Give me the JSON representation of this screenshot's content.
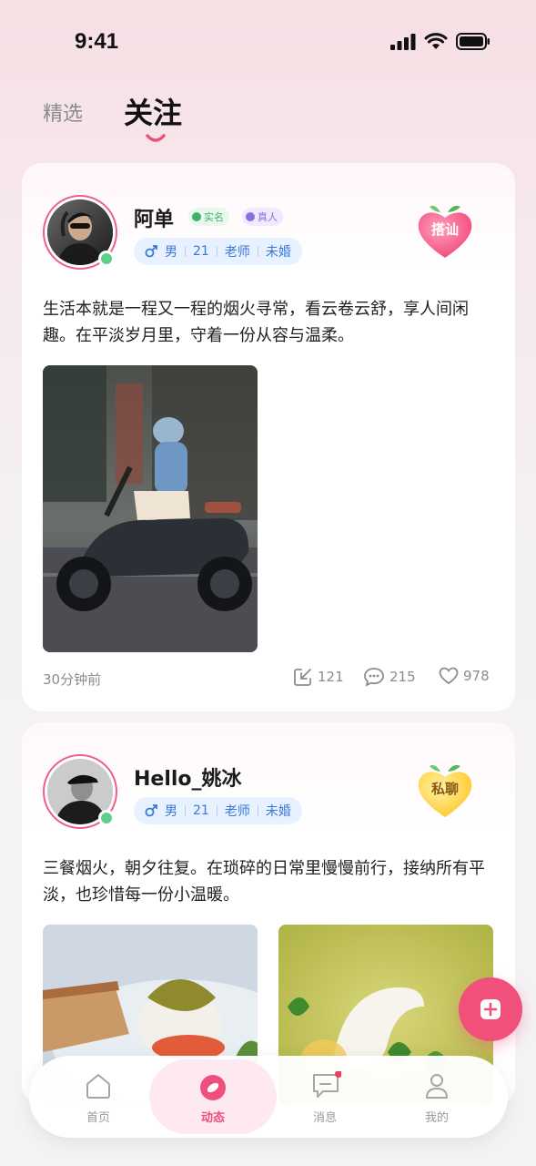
{
  "status_bar": {
    "time": "9:41"
  },
  "tabs": [
    {
      "label": "精选",
      "active": false
    },
    {
      "label": "关注",
      "active": true
    }
  ],
  "posts": [
    {
      "username": "阿单",
      "badges": [
        "实名",
        "真人"
      ],
      "tags": [
        "男",
        "21",
        "老师",
        "未婚"
      ],
      "action": "搭讪",
      "text": "生活本就是一程又一程的烟火寻常，看云卷云舒，享人间闲趣。在平淡岁月里，守着一份从容与温柔。",
      "time": "30分钟前",
      "shares": "121",
      "comments": "215",
      "likes": "978"
    },
    {
      "username": "Hello_姚冰",
      "badges": [],
      "tags": [
        "男",
        "21",
        "老师",
        "未婚"
      ],
      "action": "私聊",
      "text": "三餐烟火，朝夕往复。在琐碎的日常里慢慢前行，接纳所有平淡，也珍惜每一份小温暖。"
    }
  ],
  "bottom_nav": [
    {
      "label": "首页",
      "icon": "home-icon",
      "active": false
    },
    {
      "label": "动态",
      "icon": "feed-icon",
      "active": true
    },
    {
      "label": "消息",
      "icon": "message-icon",
      "active": false,
      "badge": true
    },
    {
      "label": "我的",
      "icon": "profile-icon",
      "active": false
    }
  ],
  "colors": {
    "accent": "#ee4f7d",
    "online": "#5fd08a",
    "tag_blue": "#3a78d8"
  }
}
